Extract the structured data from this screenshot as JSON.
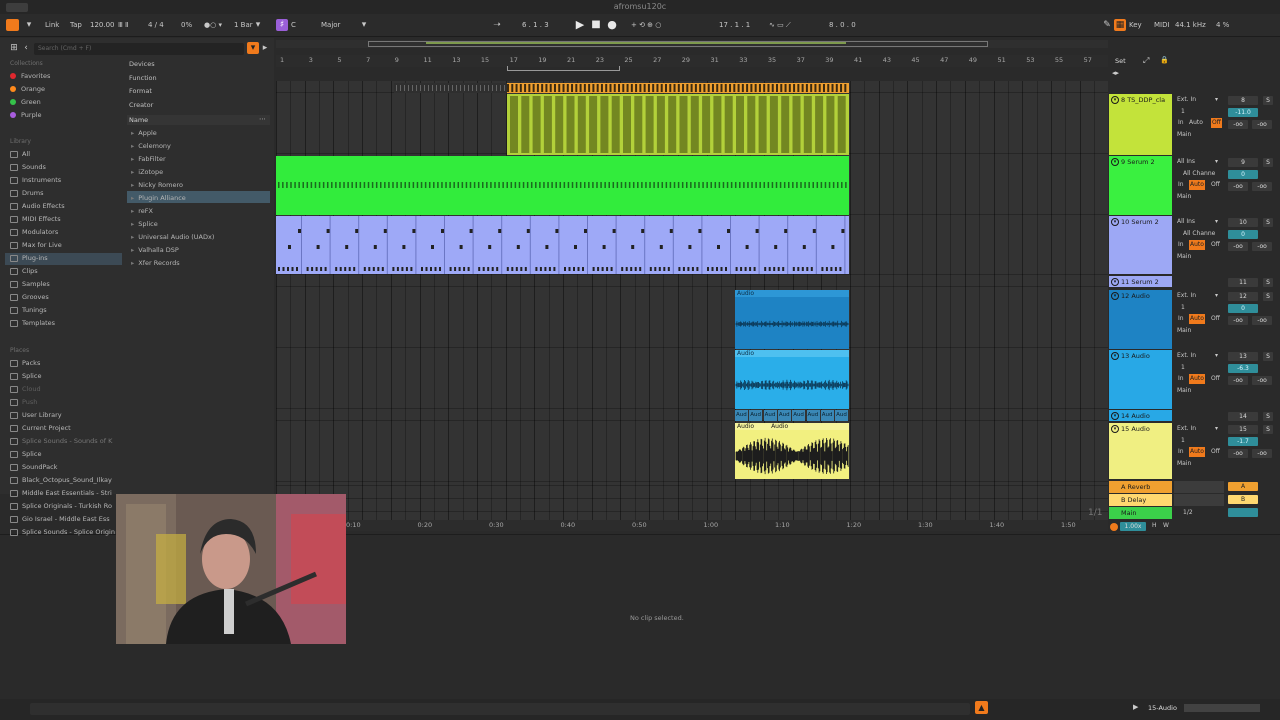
{
  "window_title": "afromsu120c",
  "transport": {
    "link": "Link",
    "tap": "Tap",
    "tempo": "120.00",
    "meter": "4 / 4",
    "cpu_top": "0%",
    "quantize": "1 Bar",
    "key": "C",
    "scale": "Major",
    "position": "6 .  1 .  3",
    "loop_start": "17 .  1 .  1",
    "loop_len": "8 .  0 .  0",
    "key_map": "Key",
    "midi_map": "MIDI",
    "sample_rate": "44.1 kHz",
    "cpu": "4 %"
  },
  "search": {
    "placeholder": "Search (Cmd + F)"
  },
  "sidebar": {
    "collections_label": "Collections",
    "collections": [
      {
        "label": "Favorites",
        "color": "#e0282e"
      },
      {
        "label": "Orange",
        "color": "#ff8a1c"
      },
      {
        "label": "Green",
        "color": "#35c24a"
      },
      {
        "label": "Purple",
        "color": "#a85dde"
      }
    ],
    "library_label": "Library",
    "library": [
      "All",
      "Sounds",
      "Instruments",
      "Drums",
      "Audio Effects",
      "MIDI Effects",
      "Modulators",
      "Max for Live",
      "Plug-ins",
      "Clips",
      "Samples",
      "Grooves",
      "Tunings",
      "Templates"
    ],
    "places_label": "Places",
    "places": [
      "Packs",
      "Splice",
      "Cloud",
      "Push",
      "User Library",
      "Current Project",
      "Splice Sounds - Sounds of K",
      "Splice",
      "SoundPack",
      "Black_Octopus_Sound_Ilkay",
      "Middle East Essentials - Stri",
      "Splice Originals - Turkish Ro",
      "Gio Israel - Middle East Ess",
      "Splice Sounds - Splice Origin"
    ]
  },
  "browser": {
    "filters": [
      "Devices",
      "Function",
      "Format",
      "Creator"
    ],
    "name_header": "Name",
    "items": [
      "Apple",
      "Celemony",
      "FabFilter",
      "iZotope",
      "Nicky Romero",
      "Plugin Alliance",
      "reFX",
      "Splice",
      "Universal Audio (UADx)",
      "Valhalla DSP",
      "Xfer Records"
    ]
  },
  "ruler": {
    "bars": [
      "1",
      "3",
      "5",
      "7",
      "9",
      "11",
      "13",
      "15",
      "17",
      "19",
      "21",
      "23",
      "25",
      "27",
      "29",
      "31",
      "33",
      "35",
      "37",
      "39",
      "41",
      "43",
      "45",
      "47",
      "49",
      "51",
      "53",
      "55",
      "57"
    ],
    "set_label": "Set"
  },
  "timeline": {
    "times": [
      "0:10",
      "0:20",
      "0:30",
      "0:40",
      "0:50",
      "1:00",
      "1:10",
      "1:20",
      "1:30",
      "1:40",
      "1:50"
    ],
    "page": "1/1"
  },
  "clips": {
    "audio_12": "Audio",
    "audio_13": "Audio",
    "audio_15a": "Audio",
    "audio_15b": "Audio",
    "aud_short": "Aud"
  },
  "tracks": [
    {
      "name": "8 TS_DDP_cla",
      "color": "#c3e33a",
      "input": "Ext. In",
      "channel": "1",
      "number": "8",
      "vol": "-11.0",
      "main": "Main",
      "auto": "Auto",
      "off": "Off",
      "in": "In"
    },
    {
      "name": "9 Serum 2",
      "color": "#3af040",
      "input": "All Ins",
      "channel": "All Channe",
      "number": "9",
      "vol": "0",
      "main": "Main",
      "auto": "Auto",
      "off": "Off",
      "in": "In"
    },
    {
      "name": "10 Serum 2",
      "color": "#9da8f5",
      "input": "All Ins",
      "channel": "All Channe",
      "number": "10",
      "vol": "0",
      "main": "Main",
      "auto": "Auto",
      "off": "Off",
      "in": "In"
    },
    {
      "name": "11 Serum 2",
      "color": "#9da8f5",
      "number": "11"
    },
    {
      "name": "12 Audio",
      "color": "#1e83c4",
      "input": "Ext. In",
      "channel": "1",
      "number": "12",
      "vol": "0",
      "main": "Main",
      "auto": "Auto",
      "off": "Off",
      "in": "In"
    },
    {
      "name": "13 Audio",
      "color": "#28a8e6",
      "input": "Ext. In",
      "channel": "1",
      "number": "13",
      "vol": "-6.3",
      "main": "Main",
      "auto": "Auto",
      "off": "Off",
      "in": "In"
    },
    {
      "name": "14 Audio",
      "color": "#28a8e6",
      "number": "14"
    },
    {
      "name": "15 Audio",
      "color": "#f0ef82",
      "input": "Ext. In",
      "channel": "1",
      "number": "15",
      "vol": "-1.7",
      "main": "Main",
      "auto": "Auto",
      "off": "Off",
      "in": "In"
    }
  ],
  "returns": [
    {
      "name": "A Reverb",
      "color": "#f0a030",
      "letter": "A"
    },
    {
      "name": "B Delay",
      "color": "#ffd870",
      "letter": "B"
    }
  ],
  "main_track": {
    "name": "Main",
    "color": "#3bd04a",
    "output": "1/2",
    "zoom": "1.00x",
    "h": "H",
    "w": "W"
  },
  "detail": {
    "no_clip": "No clip selected."
  },
  "status": {
    "selected": "15-Audio"
  }
}
